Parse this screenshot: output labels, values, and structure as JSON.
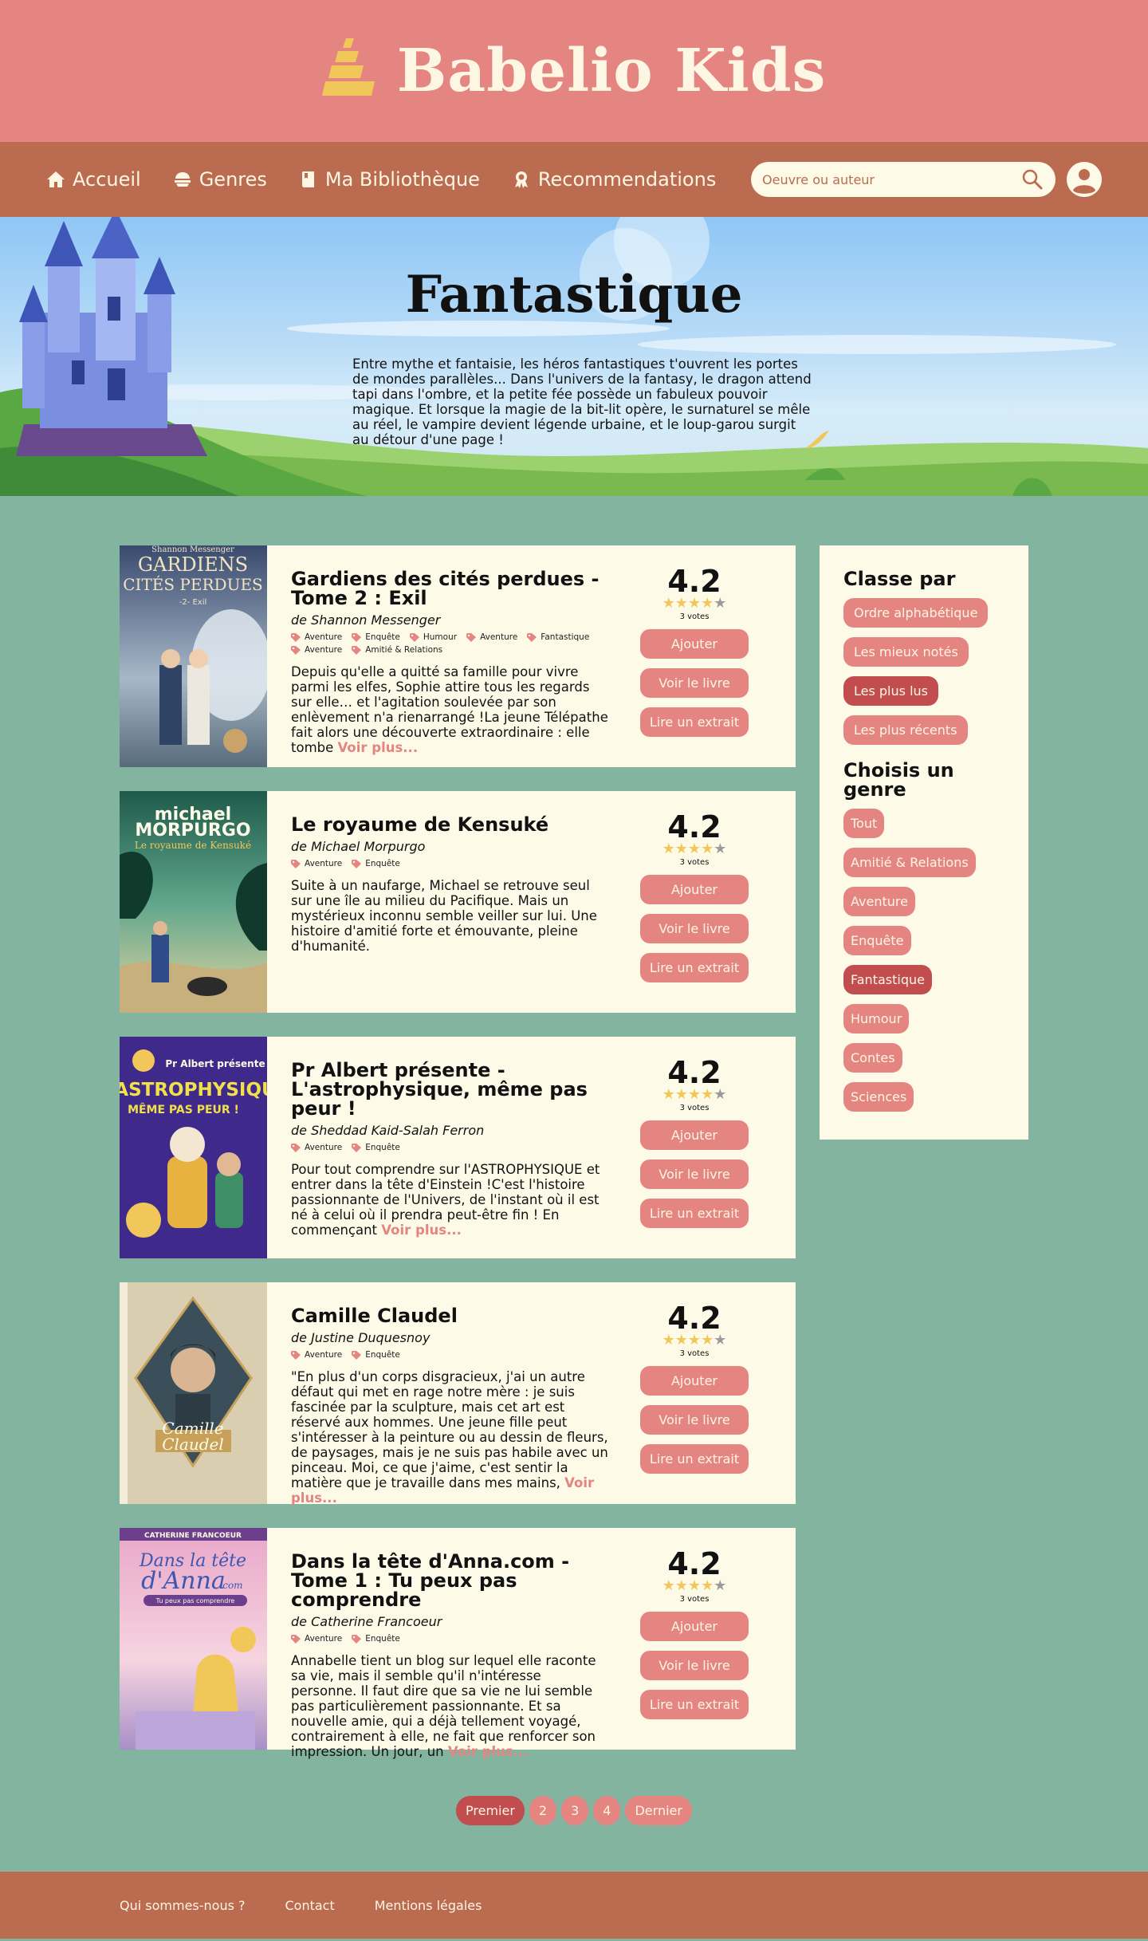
{
  "brand": {
    "title": "Babelio Kids"
  },
  "nav": {
    "items": [
      {
        "label": "Accueil",
        "icon": "home-icon"
      },
      {
        "label": "Genres",
        "icon": "genres-icon"
      },
      {
        "label": "Ma Bibliothèque",
        "icon": "book-icon"
      },
      {
        "label": "Recommendations",
        "icon": "award-icon"
      }
    ],
    "search_placeholder": "Oeuvre ou auteur"
  },
  "hero": {
    "title": "Fantastique",
    "description": "Entre mythe et fantaisie, les héros fantastiques t'ouvrent les portes de mondes parallèles... Dans l'univers de la fantasy, le dragon attend tapi dans l'ombre, et la petite fée possède un fabuleux pouvoir magique.  Et lorsque la magie de la bit-lit opère, le surnaturel se mêle au réel, le vampire devient légende urbaine, et le loup-garou surgit au détour d'une page !"
  },
  "books": [
    {
      "title": "Gardiens des cités perdues - Tome 2 : Exil",
      "author": "de Shannon Messenger",
      "tags": [
        "Aventure",
        "Enquête",
        "Humour",
        "Aventure",
        "Fantastique",
        "Aventure",
        "Amitié & Relations"
      ],
      "description": "Depuis qu'elle a quitté sa famille pour vivre parmi les elfes, Sophie attire tous les regards sur elle… et l'agitation soulevée par son enlèvement n'a rienarrangé !La jeune Télépathe fait alors une découverte extraordinaire : elle tombe",
      "see_more": "Voir plus...",
      "rating": "4.2",
      "stars": 4,
      "votes": "3 votes",
      "cover_text": [
        "Shannon Messenger",
        "GARDIENS",
        "CITÉS PERDUES",
        "-2- Exil"
      ]
    },
    {
      "title": "Le royaume de Kensuké",
      "author": "de Michael Morpurgo",
      "tags": [
        "Aventure",
        "Enquête"
      ],
      "description": "Suite à un naufarge, Michael se retrouve seul sur une île au milieu du Pacifique. Mais un mystérieux inconnu semble veiller sur lui. Une histoire d'amitié forte et émouvante, pleine d'humanité.",
      "see_more": "",
      "rating": "4.2",
      "stars": 4,
      "votes": "3 votes",
      "cover_text": [
        "michael",
        "MORPURGO",
        "Le royaume de Kensuké"
      ]
    },
    {
      "title": "Pr Albert présente - L'astrophysique, même pas peur !",
      "author": "de Sheddad Kaid-Salah Ferron",
      "tags": [
        "Aventure",
        "Enquête"
      ],
      "description": "Pour tout comprendre sur l'ASTROPHYSIQUE et entrer dans la tête d'Einstein !C'est l'histoire passionnante de l'Univers, de l'instant où il est né à celui où il prendra peut-être fin ! En commençant",
      "see_more": "Voir plus...",
      "rating": "4.2",
      "stars": 4,
      "votes": "3 votes",
      "cover_text": [
        "Pr Albert présente",
        "L'ASTROPHYSIQUE",
        "MÊME PAS PEUR !"
      ]
    },
    {
      "title": "Camille Claudel",
      "author": "de Justine Duquesnoy",
      "tags": [
        "Aventure",
        "Enquête"
      ],
      "description": "\"En plus d'un corps disgracieux, j'ai un autre défaut qui met en rage notre mère : je suis fascinée par la sculpture, mais cet art est réservé aux hommes. Une jeune fille peut s'intéresser à la peinture ou au dessin de fleurs, de paysages, mais je ne suis pas habile avec un pinceau. Moi, ce que j'aime, c'est sentir la matière que je travaille dans mes mains,",
      "see_more": "Voir plus...",
      "rating": "4.2",
      "stars": 4,
      "votes": "3 votes",
      "cover_text": [
        "Camille",
        "Claudel"
      ]
    },
    {
      "title": "Dans la tête d'Anna.com - Tome 1 : Tu peux pas comprendre",
      "author": "de Catherine Francoeur",
      "tags": [
        "Aventure",
        "Enquête"
      ],
      "description": "Annabelle tient un blog sur lequel elle raconte sa vie, mais il semble qu'il n'intéresse personne. Il faut dire que sa vie ne lui semble pas particulièrement passionnante. Et sa nouvelle amie, qui a déjà tellement voyagé, contrairement à elle, ne fait que renforcer son impression. Un jour, un",
      "see_more": "Voir plus...",
      "rating": "4.2",
      "stars": 4,
      "votes": "3 votes",
      "cover_text": [
        "CATHERINE FRANCOEUR",
        "Dans la tête",
        "d'Anna",
        ".com",
        "Tu peux pas comprendre"
      ]
    }
  ],
  "book_actions": {
    "add": "Ajouter",
    "view": "Voir le livre",
    "excerpt": "Lire un extrait"
  },
  "sidebar": {
    "sort_title": "Classe par",
    "sort_options": [
      {
        "label": "Ordre alphabétique",
        "active": false
      },
      {
        "label": "Les mieux notés",
        "active": false
      },
      {
        "label": "Les plus lus",
        "active": true
      },
      {
        "label": "Les plus récents",
        "active": false
      }
    ],
    "genre_title": "Choisis un genre",
    "genres": [
      {
        "label": "Tout",
        "active": false
      },
      {
        "label": "Amitié & Relations",
        "active": false
      },
      {
        "label": "Aventure",
        "active": false
      },
      {
        "label": "Enquête",
        "active": false
      },
      {
        "label": "Fantastique",
        "active": true
      },
      {
        "label": "Humour",
        "active": false
      },
      {
        "label": "Contes",
        "active": false
      },
      {
        "label": "Sciences",
        "active": false
      }
    ]
  },
  "pagination": [
    {
      "label": "Premier",
      "active": true
    },
    {
      "label": "2",
      "active": false
    },
    {
      "label": "3",
      "active": false
    },
    {
      "label": "4",
      "active": false
    },
    {
      "label": "Dernier",
      "active": false
    }
  ],
  "footer": {
    "links": [
      "Qui sommes-nous ?",
      "Contact",
      "Mentions légales"
    ]
  },
  "colors": {
    "header": "#e58582",
    "nav": "#bb6b4f",
    "background": "#83b4a0",
    "card": "#fdfbe8",
    "accent_active": "#c24d4e",
    "star": "#f1c75a"
  }
}
